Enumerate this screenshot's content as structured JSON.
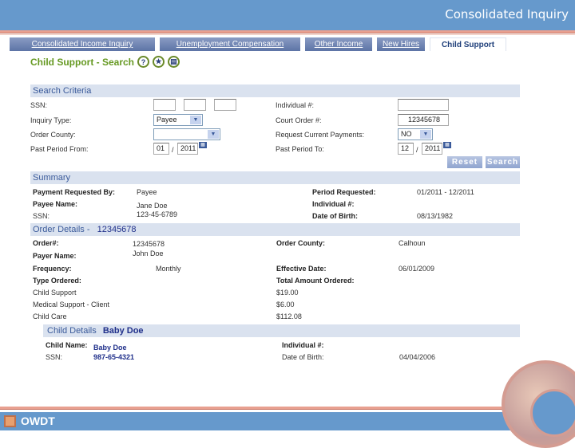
{
  "header": {
    "title": "Consolidated Inquiry"
  },
  "tabs": [
    {
      "label": "Consolidated Income Inquiry",
      "active": false
    },
    {
      "label": "Unemployment Compensation",
      "active": false
    },
    {
      "label": "Other Income",
      "active": false
    },
    {
      "label": "New Hires",
      "active": false
    },
    {
      "label": "Child Support",
      "active": true
    }
  ],
  "page": {
    "title": "Child Support - Search",
    "icons": [
      "help-icon",
      "favorite-star-icon",
      "print-document-icon"
    ]
  },
  "search": {
    "header": "Search Criteria",
    "ssn_label": "SSN:",
    "ssn_values": [
      "",
      "",
      ""
    ],
    "inquiry_type_label": "Inquiry Type:",
    "inquiry_type_value": "Payee",
    "order_county_label": "Order County:",
    "order_county_value": "",
    "past_from_label": "Past Period From:",
    "past_from_month": "01",
    "past_from_year": "2011",
    "individual_label": "Individual #:",
    "individual_value": "",
    "court_order_label": "Court Order #:",
    "court_order_value": "12345678",
    "request_current_label": "Request Current Payments:",
    "request_current_value": "NO",
    "past_to_label": "Past Period To:",
    "past_to_month": "12",
    "past_to_year": "2011",
    "date_separator": "/",
    "reset_label": "Reset",
    "search_label": "Search"
  },
  "summary": {
    "header": "Summary",
    "payment_requested_by_label": "Payment Requested By:",
    "payment_requested_by_value": "Payee",
    "payee_name_label": "Payee Name:",
    "payee_name_value": "Jane Doe",
    "ssn_label": "SSN:",
    "ssn_value": "123-45-6789",
    "period_requested_label": "Period Requested:",
    "period_requested_value": "01/2011 - 12/2011",
    "individual_label": "Individual #:",
    "individual_value": "",
    "dob_label": "Date of Birth:",
    "dob_value": "08/13/1982"
  },
  "order": {
    "header": "Order Details -",
    "header_number": "12345678",
    "order_num_label": "Order#:",
    "order_num_value": "12345678",
    "payer_name_label": "Payer Name:",
    "payer_name_value": "John Doe",
    "frequency_label": "Frequency:",
    "frequency_value": "Monthly",
    "type_ordered_label": "Type Ordered:",
    "order_county_label": "Order County:",
    "order_county_value": "Calhoun",
    "effective_date_label": "Effective Date:",
    "effective_date_value": "06/01/2009",
    "total_label": "Total Amount Ordered:",
    "items": [
      {
        "type": "Child Support",
        "amount": "$19.00"
      },
      {
        "type": "Medical Support - Client",
        "amount": "$6.00"
      },
      {
        "type": "Child Care",
        "amount": "$112.08"
      }
    ]
  },
  "child": {
    "header": "Child Details",
    "header_name": "Baby Doe",
    "name_label": "Child Name:",
    "name_value": "Baby Doe",
    "ssn_label": "SSN:",
    "ssn_value": "987-65-4321",
    "individual_label": "Individual #:",
    "individual_value": "",
    "dob_label": "Date of Birth:",
    "dob_value": "04/04/2006"
  },
  "footer": {
    "logo_text": "OWDT"
  },
  "colors": {
    "header_blue": "#6699cc",
    "accent_salmon": "#e8a090",
    "title_green": "#669922",
    "section_bg": "#dae2ef"
  }
}
